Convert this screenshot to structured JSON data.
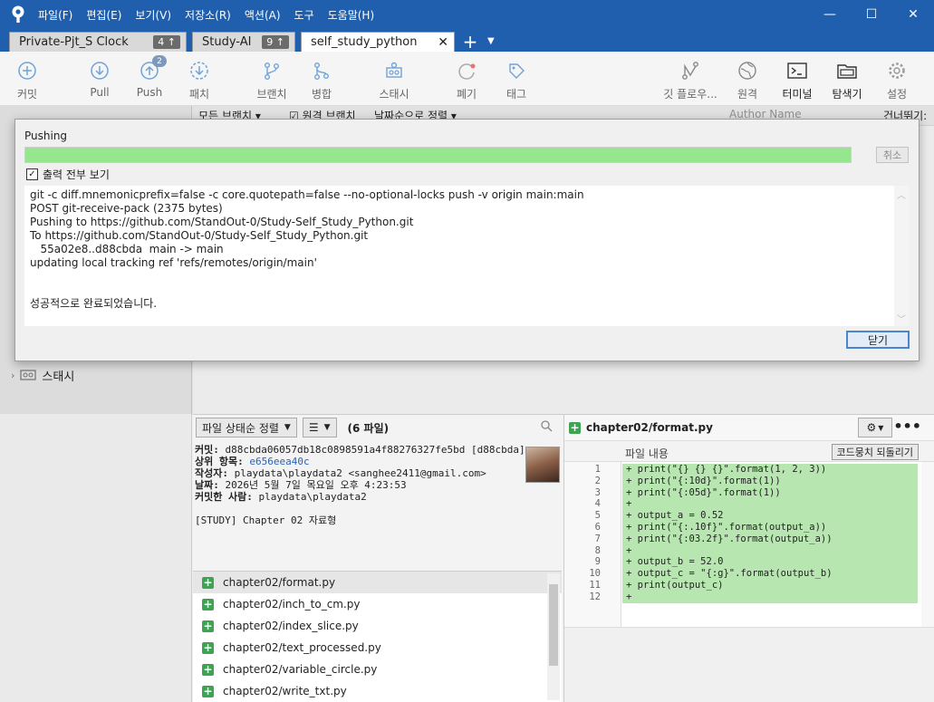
{
  "menu": [
    "파일(F)",
    "편집(E)",
    "보기(V)",
    "저장소(R)",
    "액션(A)",
    "도구",
    "도움말(H)"
  ],
  "window_controls": {
    "minimize": "—",
    "maximize": "☐",
    "close": "✕"
  },
  "tabs": [
    {
      "label": "Private-Pjt_S Clock",
      "badge": "4 ↑"
    },
    {
      "label": "Study-AI",
      "badge": "9 ↑"
    },
    {
      "label": "self_study_python",
      "close": "✕"
    }
  ],
  "tab_add": "+",
  "toolbar": {
    "commit": "커밋",
    "pull": "Pull",
    "push": "Push",
    "push_count": "2",
    "fetch": "패치",
    "branch": "브랜치",
    "merge": "병합",
    "stash": "스태시",
    "discard": "폐기",
    "tag": "태그",
    "git_flow": "깃 플로우...",
    "remote": "원격",
    "terminal": "터미널",
    "explorer": "탐색기",
    "settings": "설정"
  },
  "filter_row": {
    "all_branches": "모든 브랜치 ▾",
    "remote_branches": "☑ 원격 브랜치",
    "sort": "날짜순으로 정렬 ▾",
    "author_placeholder": "Author Name",
    "skip": "건너뛰기:"
  },
  "sidebar": {
    "stash_label": "스태시"
  },
  "dialog": {
    "title": "Pushing",
    "progress": 1.0,
    "cancel": "취소",
    "show_full_output": "출력 전부 보기",
    "show_full_checked": true,
    "output_lines": [
      "git -c diff.mnemonicprefix=false -c core.quotepath=false --no-optional-locks push -v origin main:main",
      "POST git-receive-pack (2375 bytes)",
      "Pushing to https://github.com/StandOut-0/Study-Self_Study_Python.git",
      "To https://github.com/StandOut-0/Study-Self_Study_Python.git",
      "   55a02e8..d88cbda  main -> main",
      "updating local tracking ref 'refs/remotes/origin/main'",
      "",
      "",
      "성공적으로 완료되었습니다."
    ],
    "close": "닫기"
  },
  "files_panel": {
    "sort_label": "파일 상태순 정렬",
    "view_label": "☰",
    "file_count": "(6 파일)"
  },
  "commit": {
    "commit_key": "커밋:",
    "commit_val": "d88cbda06057db18c0898591a4f88276327fe5bd [d88cbda]",
    "parent_key": "상위 항목:",
    "parent_val": "e656eea40c",
    "author_key": "작성자:",
    "author_val": "playdata\\playdata2 <sanghee2411@gmail.com>",
    "date_key": "날짜:",
    "date_val": "2026년 5월 7일 목요일 오후 4:23:53",
    "committer_key": "커밋한 사람:",
    "committer_val": "playdata\\playdata2",
    "message": "[STUDY] Chapter 02 자료형"
  },
  "files": [
    "chapter02/format.py",
    "chapter02/inch_to_cm.py",
    "chapter02/index_slice.py",
    "chapter02/text_processed.py",
    "chapter02/variable_circle.py",
    "chapter02/write_txt.py"
  ],
  "diff": {
    "file": "chapter02/format.py",
    "content_label": "파일 내용",
    "revert": "코드뭉치 되돌리기",
    "lines": [
      {
        "n": "1",
        "code": "+ print(\"{} {} {}\".format(1, 2, 3))"
      },
      {
        "n": "2",
        "code": "+ print(\"{:10d}\".format(1))"
      },
      {
        "n": "3",
        "code": "+ print(\"{:05d}\".format(1))"
      },
      {
        "n": "4",
        "code": "+"
      },
      {
        "n": "5",
        "code": "+ output_a = 0.52"
      },
      {
        "n": "6",
        "code": "+ print(\"{:.10f}\".format(output_a))"
      },
      {
        "n": "7",
        "code": "+ print(\"{:03.2f}\".format(output_a))"
      },
      {
        "n": "8",
        "code": "+"
      },
      {
        "n": "9",
        "code": "+ output_b = 52.0"
      },
      {
        "n": "10",
        "code": "+ output_c = \"{:g}\".format(output_b)"
      },
      {
        "n": "11",
        "code": "+ print(output_c)"
      },
      {
        "n": "12",
        "code": "+"
      }
    ]
  },
  "colors": {
    "titlebar": "#1f5fae",
    "progress": "#96e690",
    "diff_added": "#b8e6b1",
    "added_icon": "#3ea352"
  }
}
